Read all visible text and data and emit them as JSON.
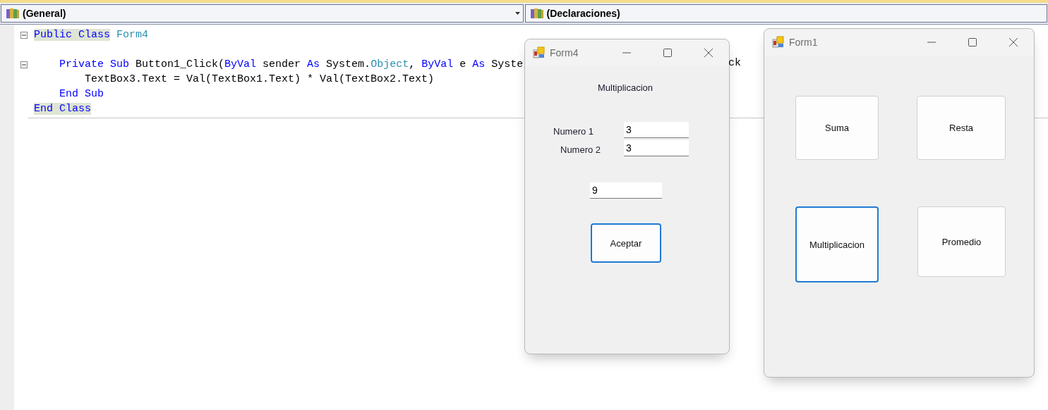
{
  "navigation_bar": {
    "class_dropdown": "(General)",
    "member_dropdown": "(Declaraciones)"
  },
  "code_editor": {
    "lines": [
      {
        "tokens": [
          {
            "kind": "match",
            "text": "Public Class"
          },
          {
            "kind": "type",
            "text": " Form4"
          }
        ],
        "children": [
          {
            "blank_line_before": true,
            "tokens": [
              {
                "kind": "keyword",
                "text": "Private Sub"
              },
              {
                "kind": "plain",
                "text": " Button1_Click("
              },
              {
                "kind": "keyword",
                "text": "ByVal"
              },
              {
                "kind": "plain",
                "text": " sender "
              },
              {
                "kind": "keyword",
                "text": "As"
              },
              {
                "kind": "plain",
                "text": " System."
              },
              {
                "kind": "type",
                "text": "Object"
              },
              {
                "kind": "plain",
                "text": ", "
              },
              {
                "kind": "keyword",
                "text": "ByVal"
              },
              {
                "kind": "plain",
                "text": " e "
              },
              {
                "kind": "keyword",
                "text": "As"
              },
              {
                "kind": "plain",
                "text": " Syste"
              }
            ],
            "tail": "ck",
            "children": [
              {
                "tokens": [
                  {
                    "kind": "plain",
                    "text": "TextBox3.Text = Val(TextBox1.Text) * Val(TextBox2.Text)"
                  }
                ]
              }
            ]
          },
          {
            "tokens": [
              {
                "kind": "keyword",
                "text": "End Sub"
              }
            ]
          }
        ]
      },
      {
        "tokens": [
          {
            "kind": "match",
            "text": "End Class"
          }
        ]
      }
    ]
  },
  "form4": {
    "title": "Form4",
    "heading": "Multiplicacion",
    "label_1": "Numero 1",
    "value_1": "3",
    "label_2": "Numero 2",
    "value_2": "3",
    "result": "9",
    "button": {
      "label": "Aceptar",
      "focused": true
    }
  },
  "form1": {
    "title": "Form1",
    "buttons": [
      {
        "label": "Suma",
        "focused": false
      },
      {
        "label": "Resta",
        "focused": false
      },
      {
        "label": "Multiplicacion",
        "focused": true
      },
      {
        "label": "Promedio",
        "focused": false
      }
    ]
  }
}
